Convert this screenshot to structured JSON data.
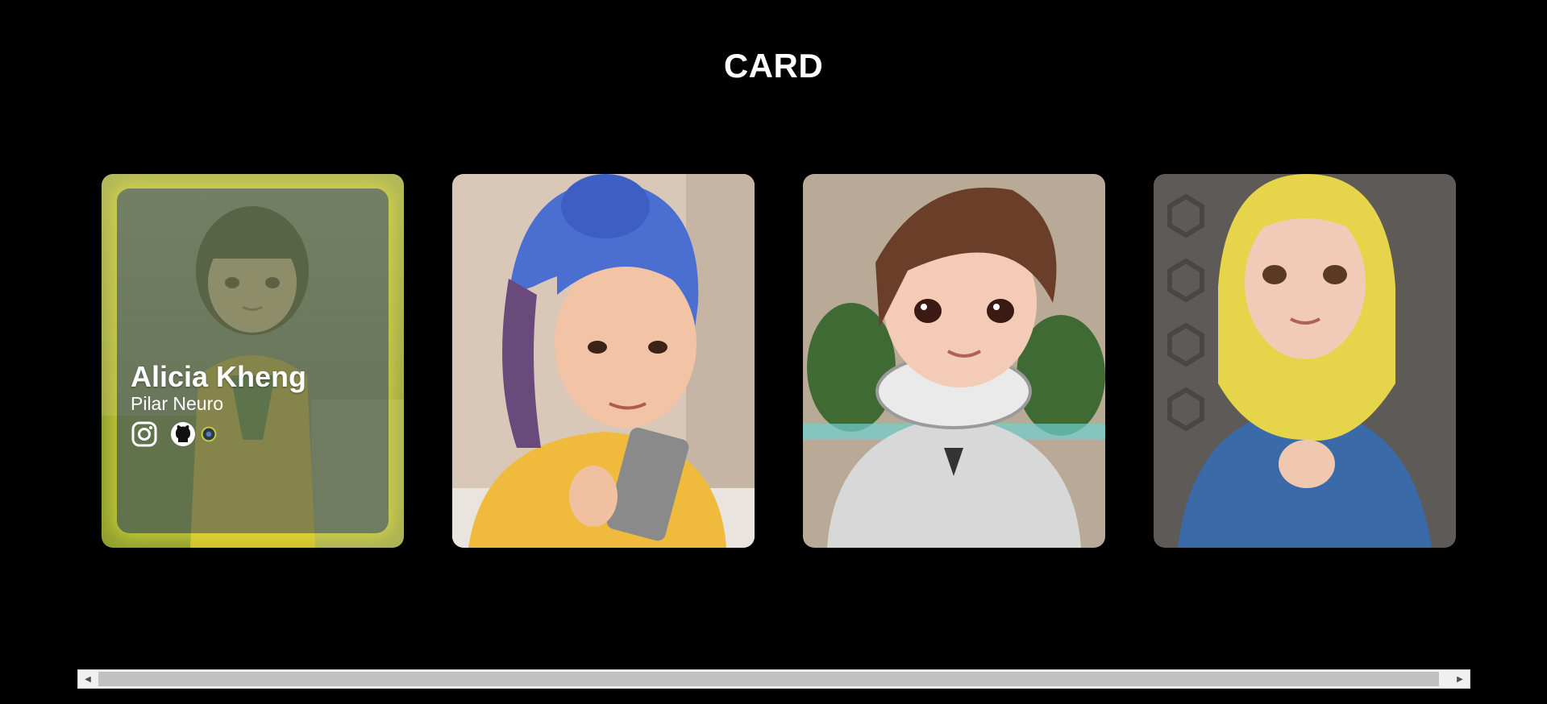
{
  "page": {
    "title": "CARD"
  },
  "cards": [
    {
      "name": "Alicia Kheng",
      "role": "Pilar Neuro",
      "social": [
        "instagram-icon",
        "github-icon",
        "extra-icon"
      ],
      "hover": true
    },
    {
      "name": "",
      "role": "",
      "hover": false
    },
    {
      "name": "",
      "role": "",
      "hover": false
    },
    {
      "name": "",
      "role": "",
      "hover": false
    }
  ],
  "colors": {
    "background": "#000000",
    "highlight": "#d6d828",
    "text": "#ffffff"
  },
  "scrollbar": {
    "left_arrow": "◀",
    "right_arrow": "▶"
  }
}
